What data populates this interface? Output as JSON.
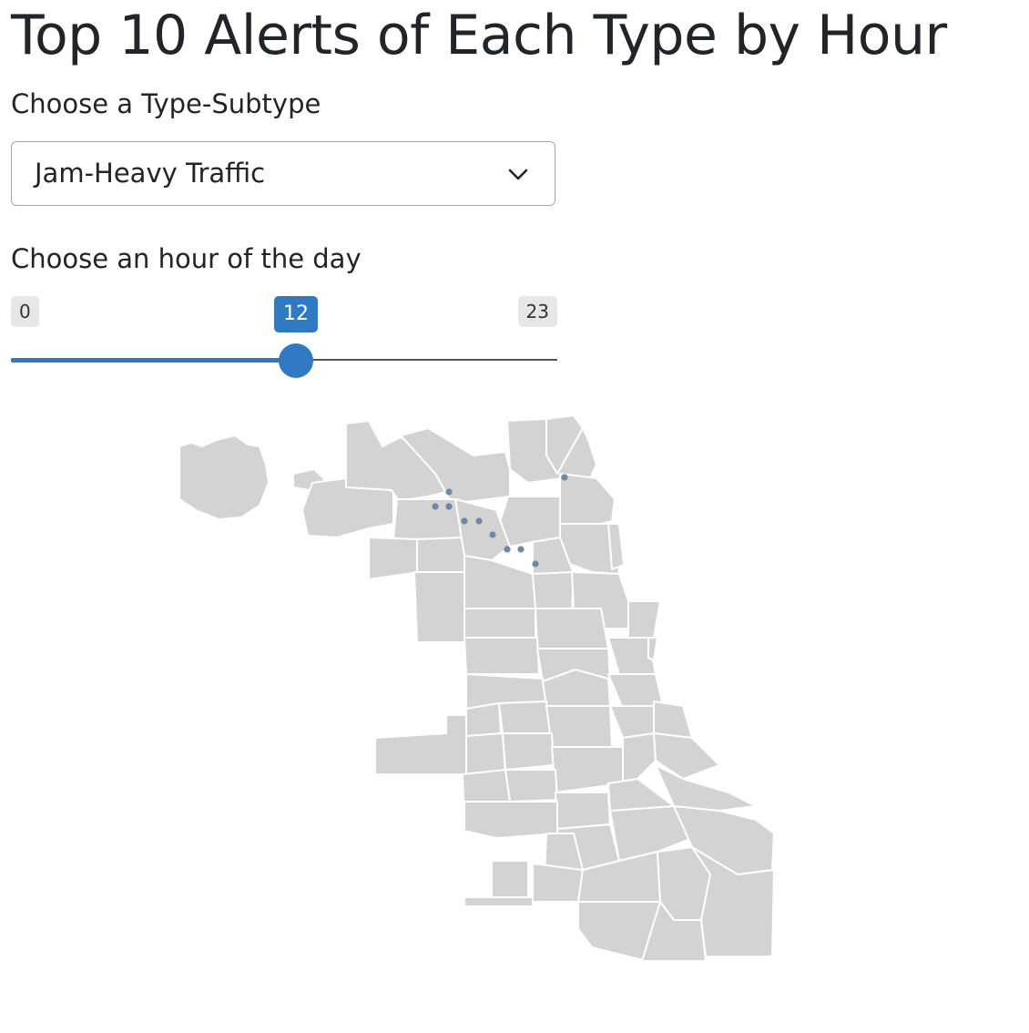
{
  "page": {
    "title": "Top 10 Alerts of Each Type by Hour"
  },
  "type_select": {
    "label": "Choose a Type-Subtype",
    "selected": "Jam-Heavy Traffic",
    "icon": "chevron-down-icon"
  },
  "hour_slider": {
    "label": "Choose an hour of the day",
    "min": 0,
    "max": 23,
    "value": 12,
    "min_label": "0",
    "max_label": "23",
    "value_label": "12",
    "color": "#2f7ac2"
  },
  "map": {
    "fill_color": "#d3d3d3",
    "border_color": "#ffffff",
    "point_color": "#6f86a8",
    "alert_count": 10
  }
}
